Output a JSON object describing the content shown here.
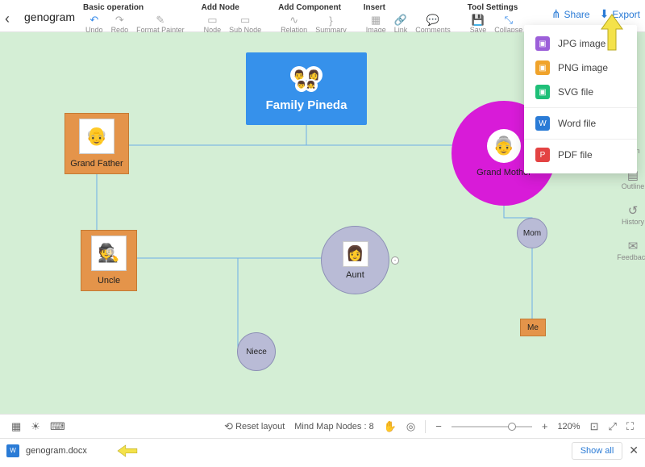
{
  "title": "genogram",
  "menu": {
    "groups": [
      {
        "title": "Basic operation",
        "items": [
          "Undo",
          "Redo",
          "Format Painter"
        ]
      },
      {
        "title": "Add Node",
        "items": [
          "Node",
          "Sub Node"
        ]
      },
      {
        "title": "Add Component",
        "items": [
          "Relation",
          "Summary"
        ]
      },
      {
        "title": "Insert",
        "items": [
          "Image",
          "Link",
          "Comments"
        ]
      },
      {
        "title": "Tool Settings",
        "items": [
          "Save",
          "Collapse"
        ]
      }
    ]
  },
  "actions": {
    "share": "Share",
    "export": "Export"
  },
  "export_menu": [
    {
      "label": "JPG image",
      "color": "#9c5fd9"
    },
    {
      "label": "PNG image",
      "color": "#f0a32b"
    },
    {
      "label": "SVG file",
      "color": "#1fbf78"
    },
    {
      "sep": true
    },
    {
      "label": "Word file",
      "color": "#2a7bd6"
    },
    {
      "sep": true
    },
    {
      "label": "PDF file",
      "color": "#e34343"
    }
  ],
  "side_rail": [
    {
      "label": "Icon"
    },
    {
      "label": "Outline"
    },
    {
      "label": "History"
    },
    {
      "label": "Feedback"
    }
  ],
  "nodes": {
    "root": "Family Pineda",
    "grandfather": "Grand Father",
    "grandmother": "Grand Mother",
    "uncle": "Uncle",
    "aunt": "Aunt",
    "mom": "Mom",
    "niece": "Niece",
    "me": "Me"
  },
  "bottom": {
    "reset": "Reset layout",
    "nodes_label": "Mind Map Nodes :",
    "nodes_count": "8",
    "zoom": "120%"
  },
  "download": {
    "filename": "genogram.docx",
    "showall": "Show all"
  }
}
